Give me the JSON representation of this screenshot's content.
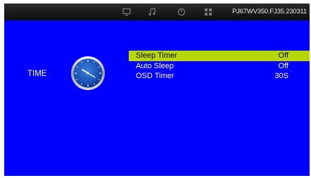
{
  "header": {
    "version": "PJ67WV350.FJ35.230311",
    "tabs": [
      {
        "icon": "monitor-icon"
      },
      {
        "icon": "music-note-icon"
      },
      {
        "icon": "clock-icon"
      },
      {
        "icon": "grid-icon"
      }
    ]
  },
  "section": {
    "label": "TIME",
    "icon": "analog-clock-icon"
  },
  "menu": {
    "items": [
      {
        "label": "Sleep Timer",
        "value": "Off"
      },
      {
        "label": "Auto Sleep",
        "value": "Off"
      },
      {
        "label": "OSD Timer",
        "value": "30S"
      }
    ],
    "selected_index": 0
  },
  "colors": {
    "background": "#0000ff",
    "highlight": "#b8d600",
    "topbar": "#1a1a1a"
  }
}
